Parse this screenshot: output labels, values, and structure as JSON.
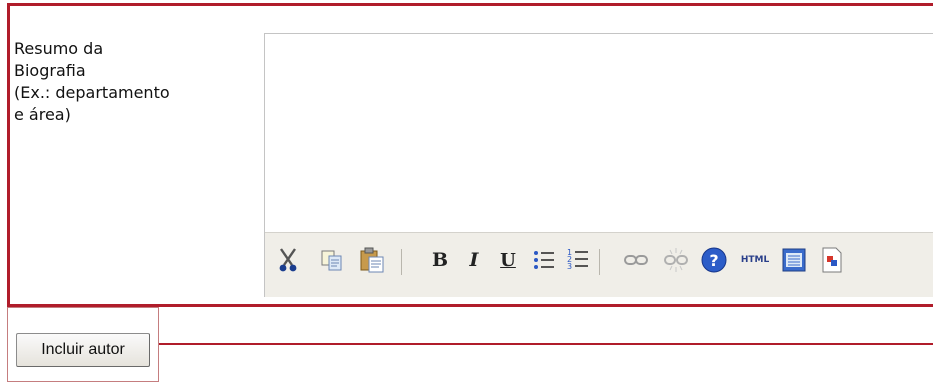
{
  "form": {
    "bio_label_lines": [
      "Resumo da",
      "Biografia",
      "(Ex.: departamento",
      "e área)"
    ],
    "bio_value": "",
    "toolbar": {
      "buttons": [
        {
          "name": "cut",
          "icon": "scissors-icon"
        },
        {
          "name": "copy",
          "icon": "copy-icon"
        },
        {
          "name": "paste",
          "icon": "paste-icon"
        },
        {
          "name": "bold",
          "icon": "bold-icon",
          "label": "B"
        },
        {
          "name": "italic",
          "icon": "italic-icon",
          "label": "I"
        },
        {
          "name": "underline",
          "icon": "underline-icon",
          "label": "U"
        },
        {
          "name": "bullet-list",
          "icon": "bullet-list-icon"
        },
        {
          "name": "numbered-list",
          "icon": "numbered-list-icon"
        },
        {
          "name": "link",
          "icon": "link-icon"
        },
        {
          "name": "unlink",
          "icon": "unlink-icon"
        },
        {
          "name": "help",
          "icon": "help-icon"
        },
        {
          "name": "html",
          "icon": "html-icon",
          "label": "HTML"
        },
        {
          "name": "source",
          "icon": "document-icon"
        },
        {
          "name": "template",
          "icon": "template-icon"
        }
      ]
    },
    "submit_label": "Incluir autor"
  },
  "colors": {
    "frame": "#b01c2a",
    "toolbar_bg": "#f0eee8"
  }
}
